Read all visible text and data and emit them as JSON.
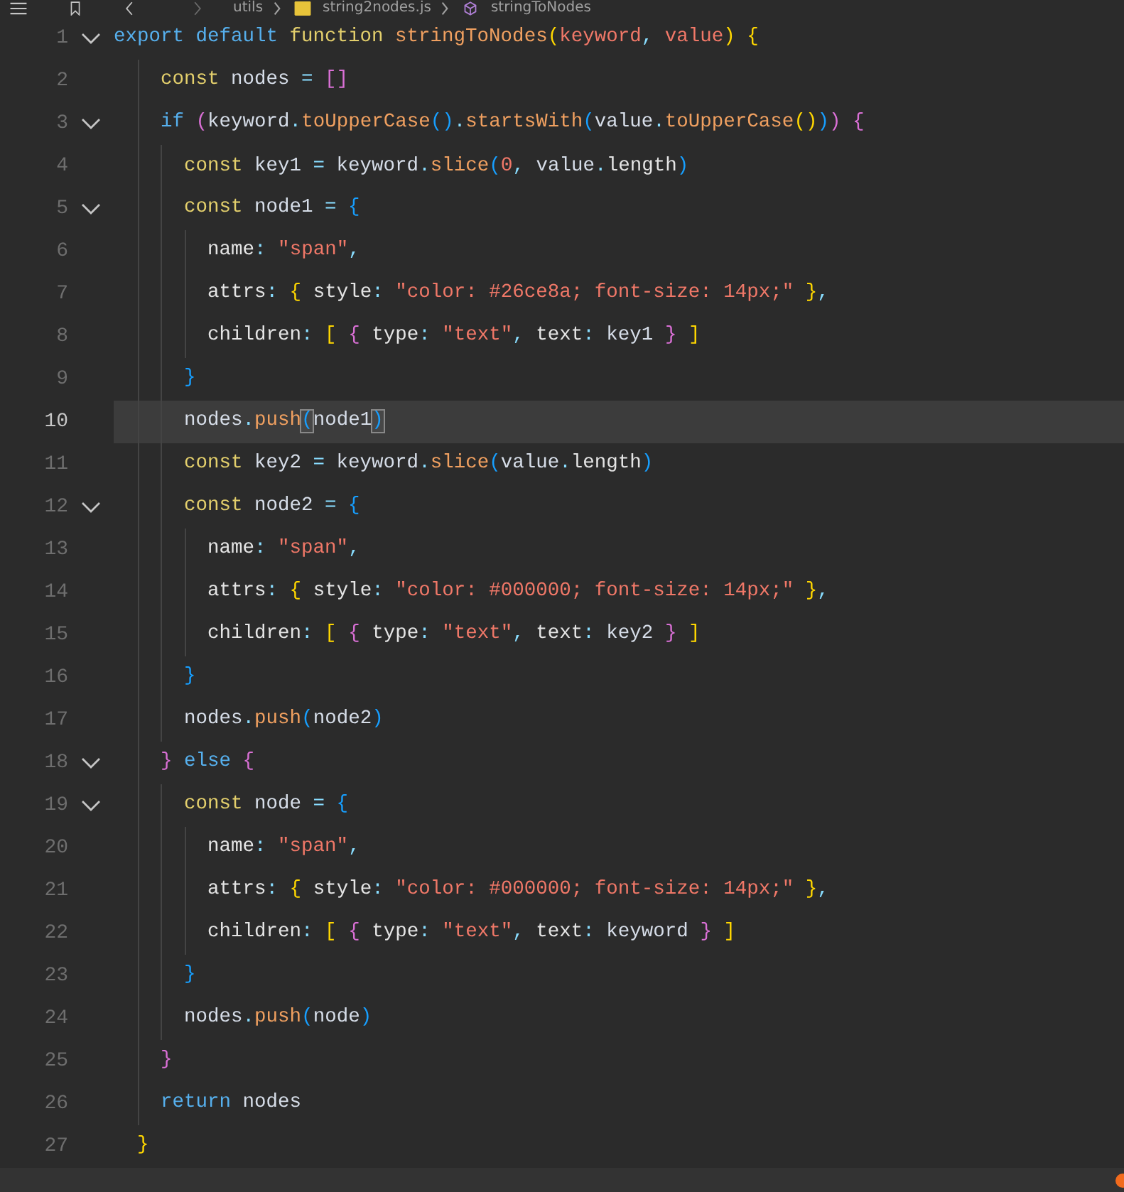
{
  "breadcrumb": [
    {
      "text": "utils",
      "kind": "folder"
    },
    {
      "text": "string2nodes.js",
      "kind": "file"
    },
    {
      "text": "stringToNodes",
      "kind": "symbol"
    }
  ],
  "lines": [
    {
      "number": "1",
      "current": false,
      "foldable": true,
      "tokens": [
        {
          "text": "export",
          "kind": "kw"
        },
        {
          "text": " default",
          "kind": "kw"
        },
        {
          "text": " function",
          "kind": "st"
        },
        {
          "text": " stringToNodes",
          "kind": "fn"
        },
        {
          "text": "(",
          "kind": "y"
        },
        {
          "text": "keyword",
          "kind": "param"
        },
        {
          "text": ",",
          "kind": "op"
        },
        {
          "text": " value",
          "kind": "param"
        },
        {
          "text": ")",
          "kind": "y"
        },
        {
          "text": " {",
          "kind": "y"
        }
      ]
    },
    {
      "number": "2",
      "current": false,
      "foldable": false,
      "tokens": [
        {
          "text": "    const",
          "kind": "st"
        },
        {
          "text": " nodes",
          "kind": "var"
        },
        {
          "text": " =",
          "kind": "op"
        },
        {
          "text": " [",
          "kind": "p"
        },
        {
          "text": "]",
          "kind": "p"
        }
      ]
    },
    {
      "number": "3",
      "current": false,
      "foldable": true,
      "tokens": [
        {
          "text": "    if",
          "kind": "kw"
        },
        {
          "text": " (",
          "kind": "p"
        },
        {
          "text": "keyword",
          "kind": "var"
        },
        {
          "text": ".",
          "kind": "op"
        },
        {
          "text": "toUpperCase",
          "kind": "fn"
        },
        {
          "text": "()",
          "kind": "b"
        },
        {
          "text": ".",
          "kind": "op"
        },
        {
          "text": "startsWith",
          "kind": "fn"
        },
        {
          "text": "(",
          "kind": "b"
        },
        {
          "text": "value",
          "kind": "var"
        },
        {
          "text": ".",
          "kind": "op"
        },
        {
          "text": "toUpperCase",
          "kind": "fn"
        },
        {
          "text": "()",
          "kind": "y"
        },
        {
          "text": ")",
          "kind": "b"
        },
        {
          "text": ")",
          "kind": "p"
        },
        {
          "text": " {",
          "kind": "p"
        }
      ]
    },
    {
      "number": "4",
      "current": false,
      "foldable": false,
      "tokens": [
        {
          "text": "      const",
          "kind": "st"
        },
        {
          "text": " key1",
          "kind": "var"
        },
        {
          "text": " =",
          "kind": "op"
        },
        {
          "text": " keyword",
          "kind": "var"
        },
        {
          "text": ".",
          "kind": "op"
        },
        {
          "text": "slice",
          "kind": "fn"
        },
        {
          "text": "(",
          "kind": "b"
        },
        {
          "text": "0",
          "kind": "num"
        },
        {
          "text": ",",
          "kind": "op"
        },
        {
          "text": " value",
          "kind": "var"
        },
        {
          "text": ".",
          "kind": "op"
        },
        {
          "text": "length",
          "kind": "prop"
        },
        {
          "text": ")",
          "kind": "b"
        }
      ]
    },
    {
      "number": "5",
      "current": false,
      "foldable": true,
      "tokens": [
        {
          "text": "      const",
          "kind": "st"
        },
        {
          "text": " node1",
          "kind": "var"
        },
        {
          "text": " =",
          "kind": "op"
        },
        {
          "text": " {",
          "kind": "b"
        }
      ]
    },
    {
      "number": "6",
      "current": false,
      "foldable": false,
      "tokens": [
        {
          "text": "        name",
          "kind": "prop"
        },
        {
          "text": ":",
          "kind": "op"
        },
        {
          "text": " \"",
          "kind": "str"
        },
        {
          "text": "span",
          "kind": "str"
        },
        {
          "text": "\"",
          "kind": "str"
        },
        {
          "text": ",",
          "kind": "op"
        }
      ]
    },
    {
      "number": "7",
      "current": false,
      "foldable": false,
      "tokens": [
        {
          "text": "        attrs",
          "kind": "prop"
        },
        {
          "text": ":",
          "kind": "op"
        },
        {
          "text": " {",
          "kind": "y"
        },
        {
          "text": " style",
          "kind": "prop"
        },
        {
          "text": ":",
          "kind": "op"
        },
        {
          "text": " \"color: #26ce8a; font-size: 14px;\"",
          "kind": "str"
        },
        {
          "text": " }",
          "kind": "y"
        },
        {
          "text": ",",
          "kind": "op"
        }
      ]
    },
    {
      "number": "8",
      "current": false,
      "foldable": false,
      "tokens": [
        {
          "text": "        children",
          "kind": "prop"
        },
        {
          "text": ":",
          "kind": "op"
        },
        {
          "text": " [",
          "kind": "y"
        },
        {
          "text": " {",
          "kind": "p"
        },
        {
          "text": " type",
          "kind": "prop"
        },
        {
          "text": ":",
          "kind": "op"
        },
        {
          "text": " \"text\"",
          "kind": "str"
        },
        {
          "text": ",",
          "kind": "op"
        },
        {
          "text": " text",
          "kind": "prop"
        },
        {
          "text": ":",
          "kind": "op"
        },
        {
          "text": " key1",
          "kind": "var"
        },
        {
          "text": " }",
          "kind": "p"
        },
        {
          "text": " ]",
          "kind": "y"
        }
      ]
    },
    {
      "number": "9",
      "current": false,
      "foldable": false,
      "tokens": [
        {
          "text": "      }",
          "kind": "b"
        }
      ]
    },
    {
      "number": "10",
      "current": true,
      "foldable": false,
      "tokens": [
        {
          "text": "      nodes",
          "kind": "var"
        },
        {
          "text": ".",
          "kind": "op"
        },
        {
          "text": "push",
          "kind": "fn"
        },
        {
          "text": "(",
          "kind": "bm"
        },
        {
          "text": "node1",
          "kind": "var"
        },
        {
          "text": ")",
          "kind": "bm"
        }
      ]
    },
    {
      "number": "11",
      "current": false,
      "foldable": false,
      "tokens": [
        {
          "text": "      const",
          "kind": "st"
        },
        {
          "text": " key2",
          "kind": "var"
        },
        {
          "text": " =",
          "kind": "op"
        },
        {
          "text": " keyword",
          "kind": "var"
        },
        {
          "text": ".",
          "kind": "op"
        },
        {
          "text": "slice",
          "kind": "fn"
        },
        {
          "text": "(",
          "kind": "b"
        },
        {
          "text": "value",
          "kind": "var"
        },
        {
          "text": ".",
          "kind": "op"
        },
        {
          "text": "length",
          "kind": "prop"
        },
        {
          "text": ")",
          "kind": "b"
        }
      ]
    },
    {
      "number": "12",
      "current": false,
      "foldable": true,
      "tokens": [
        {
          "text": "      const",
          "kind": "st"
        },
        {
          "text": " node2",
          "kind": "var"
        },
        {
          "text": " =",
          "kind": "op"
        },
        {
          "text": " {",
          "kind": "b"
        }
      ]
    },
    {
      "number": "13",
      "current": false,
      "foldable": false,
      "tokens": [
        {
          "text": "        name",
          "kind": "prop"
        },
        {
          "text": ":",
          "kind": "op"
        },
        {
          "text": " \"span\"",
          "kind": "str"
        },
        {
          "text": ",",
          "kind": "op"
        }
      ]
    },
    {
      "number": "14",
      "current": false,
      "foldable": false,
      "tokens": [
        {
          "text": "        attrs",
          "kind": "prop"
        },
        {
          "text": ":",
          "kind": "op"
        },
        {
          "text": " {",
          "kind": "y"
        },
        {
          "text": " style",
          "kind": "prop"
        },
        {
          "text": ":",
          "kind": "op"
        },
        {
          "text": " \"color: #000000; font-size: 14px;\"",
          "kind": "str"
        },
        {
          "text": " }",
          "kind": "y"
        },
        {
          "text": ",",
          "kind": "op"
        }
      ]
    },
    {
      "number": "15",
      "current": false,
      "foldable": false,
      "tokens": [
        {
          "text": "        children",
          "kind": "prop"
        },
        {
          "text": ":",
          "kind": "op"
        },
        {
          "text": " [",
          "kind": "y"
        },
        {
          "text": " {",
          "kind": "p"
        },
        {
          "text": " type",
          "kind": "prop"
        },
        {
          "text": ":",
          "kind": "op"
        },
        {
          "text": " \"text\"",
          "kind": "str"
        },
        {
          "text": ",",
          "kind": "op"
        },
        {
          "text": " text",
          "kind": "prop"
        },
        {
          "text": ":",
          "kind": "op"
        },
        {
          "text": " key2",
          "kind": "var"
        },
        {
          "text": " }",
          "kind": "p"
        },
        {
          "text": " ]",
          "kind": "y"
        }
      ]
    },
    {
      "number": "16",
      "current": false,
      "foldable": false,
      "tokens": [
        {
          "text": "      }",
          "kind": "b"
        }
      ]
    },
    {
      "number": "17",
      "current": false,
      "foldable": false,
      "tokens": [
        {
          "text": "      nodes",
          "kind": "var"
        },
        {
          "text": ".",
          "kind": "op"
        },
        {
          "text": "push",
          "kind": "fn"
        },
        {
          "text": "(",
          "kind": "b"
        },
        {
          "text": "node2",
          "kind": "var"
        },
        {
          "text": ")",
          "kind": "b"
        }
      ]
    },
    {
      "number": "18",
      "current": false,
      "foldable": true,
      "tokens": [
        {
          "text": "    }",
          "kind": "p"
        },
        {
          "text": " else",
          "kind": "kw"
        },
        {
          "text": " {",
          "kind": "p"
        }
      ]
    },
    {
      "number": "19",
      "current": false,
      "foldable": true,
      "tokens": [
        {
          "text": "      const",
          "kind": "st"
        },
        {
          "text": " node",
          "kind": "var"
        },
        {
          "text": " =",
          "kind": "op"
        },
        {
          "text": " {",
          "kind": "b"
        }
      ]
    },
    {
      "number": "20",
      "current": false,
      "foldable": false,
      "tokens": [
        {
          "text": "        name",
          "kind": "prop"
        },
        {
          "text": ":",
          "kind": "op"
        },
        {
          "text": " \"span\"",
          "kind": "str"
        },
        {
          "text": ",",
          "kind": "op"
        }
      ]
    },
    {
      "number": "21",
      "current": false,
      "foldable": false,
      "tokens": [
        {
          "text": "        attrs",
          "kind": "prop"
        },
        {
          "text": ":",
          "kind": "op"
        },
        {
          "text": " {",
          "kind": "y"
        },
        {
          "text": " style",
          "kind": "prop"
        },
        {
          "text": ":",
          "kind": "op"
        },
        {
          "text": " \"color: #000000; font-size: 14px;\"",
          "kind": "str"
        },
        {
          "text": " }",
          "kind": "y"
        },
        {
          "text": ",",
          "kind": "op"
        }
      ]
    },
    {
      "number": "22",
      "current": false,
      "foldable": false,
      "tokens": [
        {
          "text": "        children",
          "kind": "prop"
        },
        {
          "text": ":",
          "kind": "op"
        },
        {
          "text": " [",
          "kind": "y"
        },
        {
          "text": " {",
          "kind": "p"
        },
        {
          "text": " type",
          "kind": "prop"
        },
        {
          "text": ":",
          "kind": "op"
        },
        {
          "text": " \"text\"",
          "kind": "str"
        },
        {
          "text": ",",
          "kind": "op"
        },
        {
          "text": " text",
          "kind": "prop"
        },
        {
          "text": ":",
          "kind": "op"
        },
        {
          "text": " keyword",
          "kind": "var"
        },
        {
          "text": " }",
          "kind": "p"
        },
        {
          "text": " ]",
          "kind": "y"
        }
      ]
    },
    {
      "number": "23",
      "current": false,
      "foldable": false,
      "tokens": [
        {
          "text": "      }",
          "kind": "b"
        }
      ]
    },
    {
      "number": "24",
      "current": false,
      "foldable": false,
      "tokens": [
        {
          "text": "      nodes",
          "kind": "var"
        },
        {
          "text": ".",
          "kind": "op"
        },
        {
          "text": "push",
          "kind": "fn"
        },
        {
          "text": "(",
          "kind": "b"
        },
        {
          "text": "node",
          "kind": "var"
        },
        {
          "text": ")",
          "kind": "b"
        }
      ]
    },
    {
      "number": "25",
      "current": false,
      "foldable": false,
      "tokens": [
        {
          "text": "    }",
          "kind": "p"
        }
      ]
    },
    {
      "number": "26",
      "current": false,
      "foldable": false,
      "tokens": [
        {
          "text": "    return",
          "kind": "kw"
        },
        {
          "text": " nodes",
          "kind": "var"
        }
      ]
    },
    {
      "number": "27",
      "current": false,
      "foldable": false,
      "tokens": [
        {
          "text": "  }",
          "kind": "y"
        }
      ]
    }
  ]
}
